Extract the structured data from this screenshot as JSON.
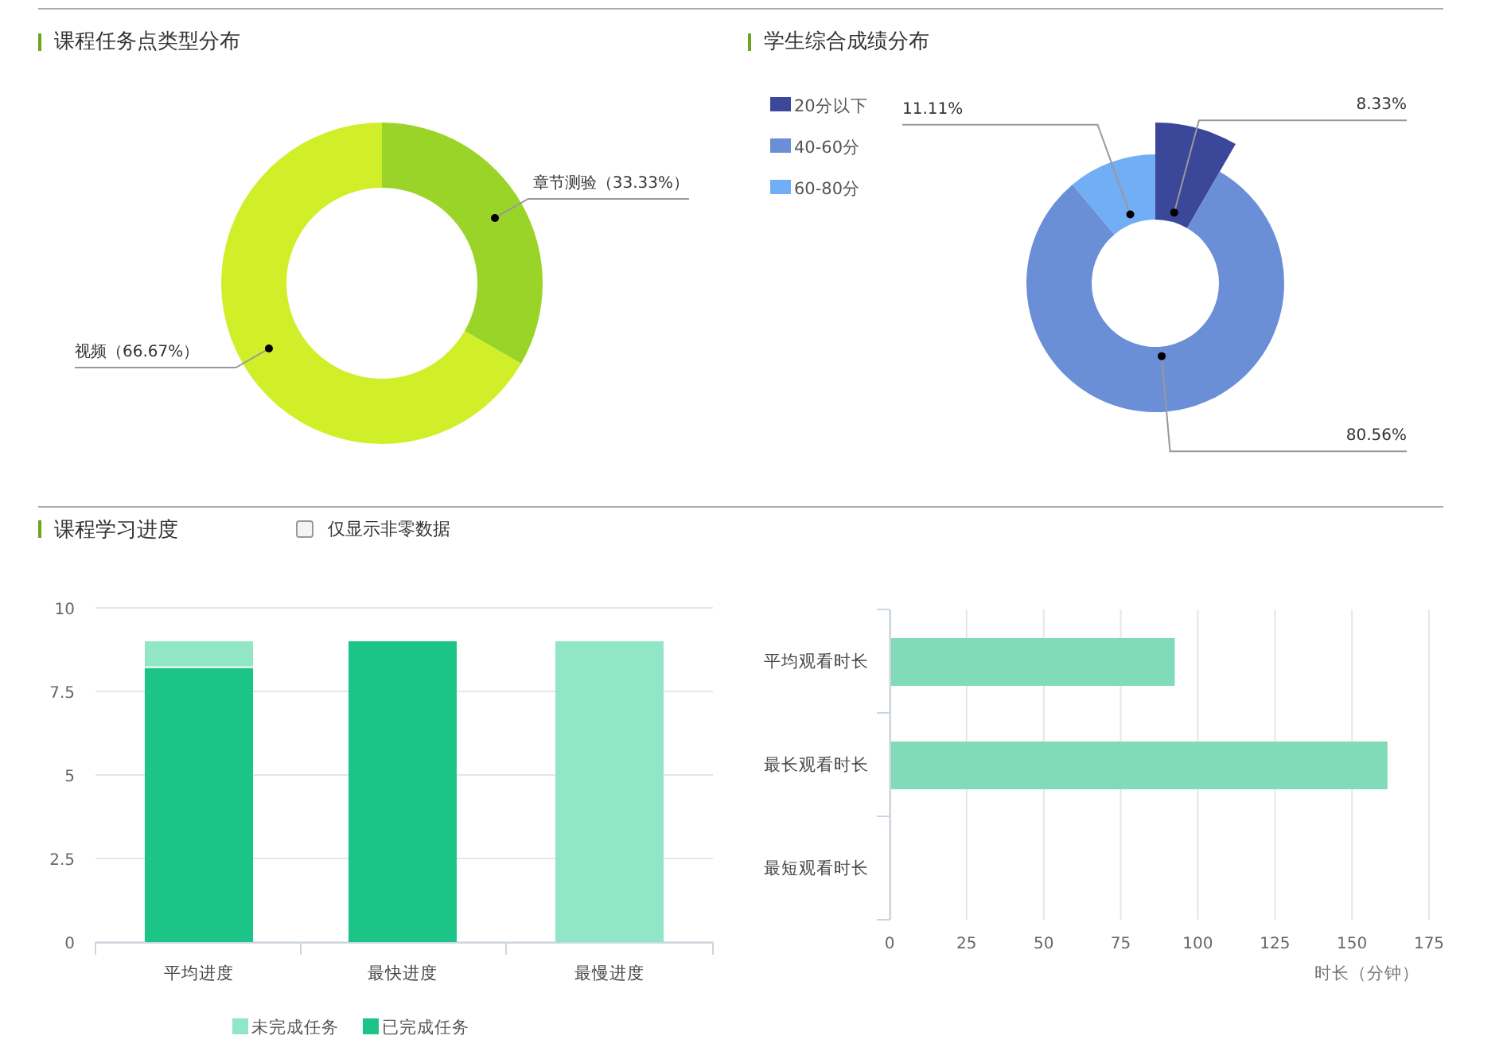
{
  "course_task_types": {
    "title": "课程任务点类型分布",
    "slices": [
      {
        "color": "#9bd428"
      },
      {
        "color": "#d1ef29"
      }
    ],
    "chart_data": {
      "type": "donut",
      "categories": [
        "章节测验（33.33%）",
        "视频（66.67%）"
      ],
      "values": [
        33.33,
        66.67
      ]
    }
  },
  "score_distribution": {
    "title": "学生综合成绩分布",
    "slices": [
      {
        "color": "#3b4799"
      },
      {
        "color": "#6a8fd6"
      },
      {
        "color": "#71aef5"
      }
    ],
    "chart_data": {
      "type": "donut",
      "legend": "top-left",
      "categories": [
        "20分以下",
        "40-60分",
        "60-80分"
      ],
      "values": [
        8.33,
        80.56,
        11.11
      ],
      "value_labels": [
        "8.33%",
        "80.56%",
        "11.11%"
      ]
    }
  },
  "course_progress": {
    "title": "课程学习进度",
    "nonzero_only": {
      "label": "仅显示非零数据",
      "checked": false
    },
    "chart_data": {
      "type": "bar",
      "categories": [
        "平均进度",
        "最快进度",
        "最慢进度"
      ],
      "stacked": true,
      "grid": true,
      "legend": "bottom",
      "ylim": [
        0,
        10
      ],
      "yticks": [
        0,
        2.5,
        5,
        7.5,
        10
      ],
      "series": [
        {
          "name": "未完成任务",
          "color": "#92e6c8",
          "values": [
            0.8,
            0,
            9
          ]
        },
        {
          "name": "已完成任务",
          "color": "#1cc587",
          "values": [
            8.2,
            9,
            0
          ]
        }
      ]
    }
  },
  "watch_time": {
    "chart_data": {
      "type": "bar",
      "orientation": "horizontal",
      "grid": true,
      "categories": [
        "平均观看时长",
        "最长观看时长",
        "最短观看时长"
      ],
      "xlim": [
        0,
        175
      ],
      "xticks": [
        0,
        25,
        50,
        75,
        100,
        125,
        150,
        175
      ],
      "xlabel": "时长（分钟）",
      "series": [
        {
          "color": "#7fdbb8",
          "values": [
            92,
            161,
            0
          ]
        }
      ]
    }
  }
}
